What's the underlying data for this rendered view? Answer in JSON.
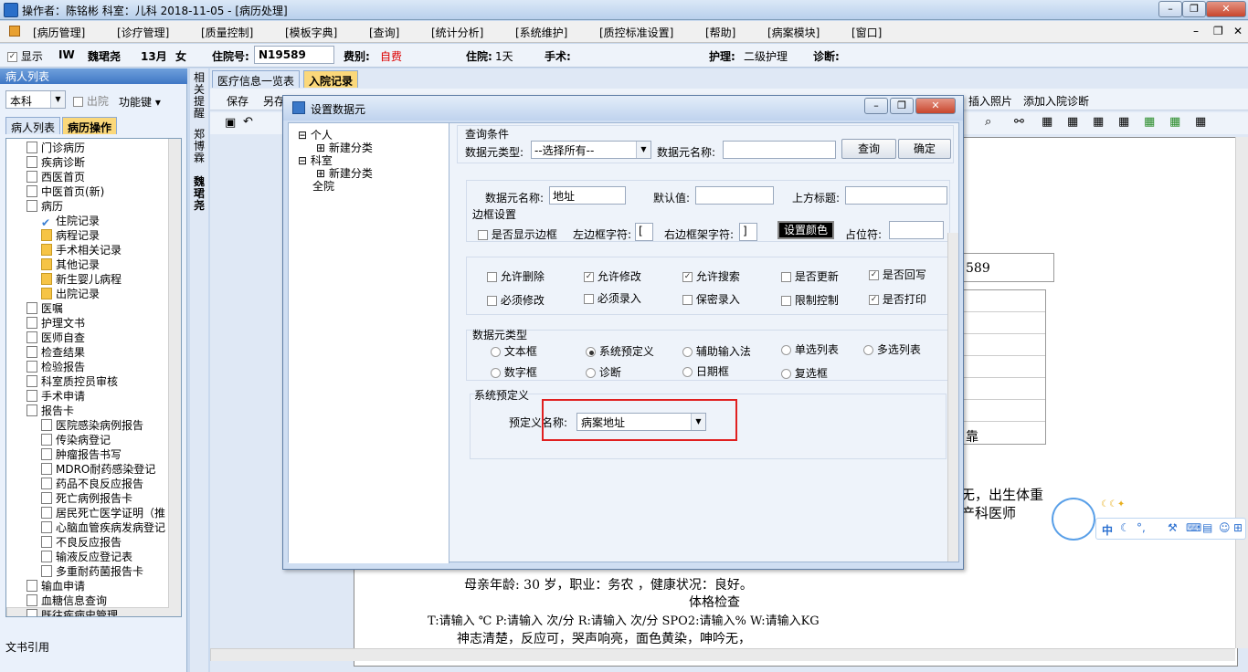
{
  "titlebar": {
    "text": "操作者：陈铭彬  科室：儿科  2018-11-05 - [病历处理]"
  },
  "window_controls": [
    "–",
    "❐",
    "✕"
  ],
  "menu": [
    "[病历管理]",
    "[诊疗管理]",
    "[质量控制]",
    "[模板字典]",
    "[查询]",
    "[统计分析]",
    "[系统维护]",
    "[质控标准设置]",
    "[帮助]",
    "[病案模块]",
    "[窗口]"
  ],
  "infobar": {
    "show_label": "显示",
    "hsp": "IW",
    "name": "魏珺尧",
    "age": "13月",
    "sex": "女",
    "inpatient_label": "住院号:",
    "inpatient_no": "N19589",
    "fee_label": "费别:",
    "fee_value": "自费",
    "stay_label": "住院:",
    "stay_value": "1天",
    "surgery_label": "手术:",
    "nursing_label": "护理:",
    "nursing_value": "二级护理",
    "diag_label": "诊断:"
  },
  "left": {
    "header": "病人列表",
    "dept": "本科",
    "discharged": "出院",
    "functions": "功能键",
    "tab1": "病人列表",
    "tab2": "病历操作",
    "bottom": "文书引用"
  },
  "tree": [
    "门诊病历",
    "疾病诊断",
    "西医首页",
    "中医首页(新)",
    "病历",
    "住院记录",
    "病程记录",
    "手术相关记录",
    "其他记录",
    "新生婴儿病程",
    "出院记录",
    "医嘱",
    "护理文书",
    "医师自查",
    "检查结果",
    "检验报告",
    "科室质控员审核",
    "手术申请",
    "报告卡",
    "医院感染病例报告",
    "传染病登记",
    "肿瘤报告书写",
    "MDRO耐药感染登记",
    "药品不良反应报告",
    "死亡病例报告卡",
    "居民死亡医学证明（推",
    "心脑血管疾病发病登记",
    "不良反应报告",
    "输液反应登记表",
    "多重耐药菌报告卡",
    "输血申请",
    "血糖信息查询",
    "既往疾病史管理"
  ],
  "vtabs": [
    "相关提醒",
    "郑博霖",
    "魏珺尧"
  ],
  "doc": {
    "tab1": "医疗信息一览表",
    "tab2": "入院记录",
    "save": "保存",
    "other": "另存",
    "insert_photo": "插入照片",
    "add_diag": "添加入院诊断"
  },
  "doctext": {
    "no": "589",
    "line_a": "无，出生体重",
    "line_b": "产科医师",
    "line_c": "靠",
    "mother": "母亲年龄:  30  岁，职业：务农  ，健康状况：良好。",
    "exam_title": "体格检查",
    "vitals": "T:请输入 ℃    P:请输入  次/分    R:请输入  次/分     SPO2:请输入%    W:请输入KG",
    "general": "神志清楚，反应可，哭声响亮，面色黄染，呻吟无，"
  },
  "dialog": {
    "title": "设置数据元",
    "tree": [
      "个人",
      "新建分类",
      "科室",
      "新建分类",
      "全院"
    ],
    "query": {
      "title": "查询条件",
      "type_label": "数据元类型:",
      "type_value": "--选择所有--",
      "name_label": "数据元名称:",
      "name_value": "",
      "query_btn": "查询",
      "ok_btn": "确定"
    },
    "fields": {
      "name_label": "数据元名称:",
      "name_value": "地址",
      "default_label": "默认值:",
      "default_value": "",
      "top_label": "上方标题:",
      "top_value": ""
    },
    "border": {
      "title": "边框设置",
      "show": "是否显示边框",
      "left_label": "左边框字符:",
      "left_value": "[",
      "right_label": "右边框架字符:",
      "right_value": "]",
      "color_btn": "设置颜色",
      "placeholder_label": "占位符:",
      "placeholder_value": ""
    },
    "checks": [
      {
        "label": "允许删除",
        "on": false
      },
      {
        "label": "允许修改",
        "on": true
      },
      {
        "label": "允许搜索",
        "on": true
      },
      {
        "label": "是否更新",
        "on": false
      },
      {
        "label": "是否回写",
        "on": true
      },
      {
        "label": "必须修改",
        "on": false
      },
      {
        "label": "必须录入",
        "on": false
      },
      {
        "label": "保密录入",
        "on": false
      },
      {
        "label": "限制控制",
        "on": false
      },
      {
        "label": "是否打印",
        "on": true
      }
    ],
    "types": {
      "title": "数据元类型",
      "items": [
        {
          "label": "文本框",
          "on": false
        },
        {
          "label": "系统预定义",
          "on": true
        },
        {
          "label": "辅助输入法",
          "on": false
        },
        {
          "label": "单选列表",
          "on": false
        },
        {
          "label": "多选列表",
          "on": false
        },
        {
          "label": "数字框",
          "on": false
        },
        {
          "label": "诊断",
          "on": false
        },
        {
          "label": "日期框",
          "on": false
        },
        {
          "label": "复选框",
          "on": false
        }
      ]
    },
    "predef": {
      "title": "系统预定义",
      "label": "预定义名称:",
      "value": "病案地址"
    },
    "controls": [
      "–",
      "❐",
      "✕"
    ]
  },
  "ime": {
    "label": "中"
  },
  "colors": {
    "highlight": "#e02020",
    "accent": "#fbd87a"
  }
}
